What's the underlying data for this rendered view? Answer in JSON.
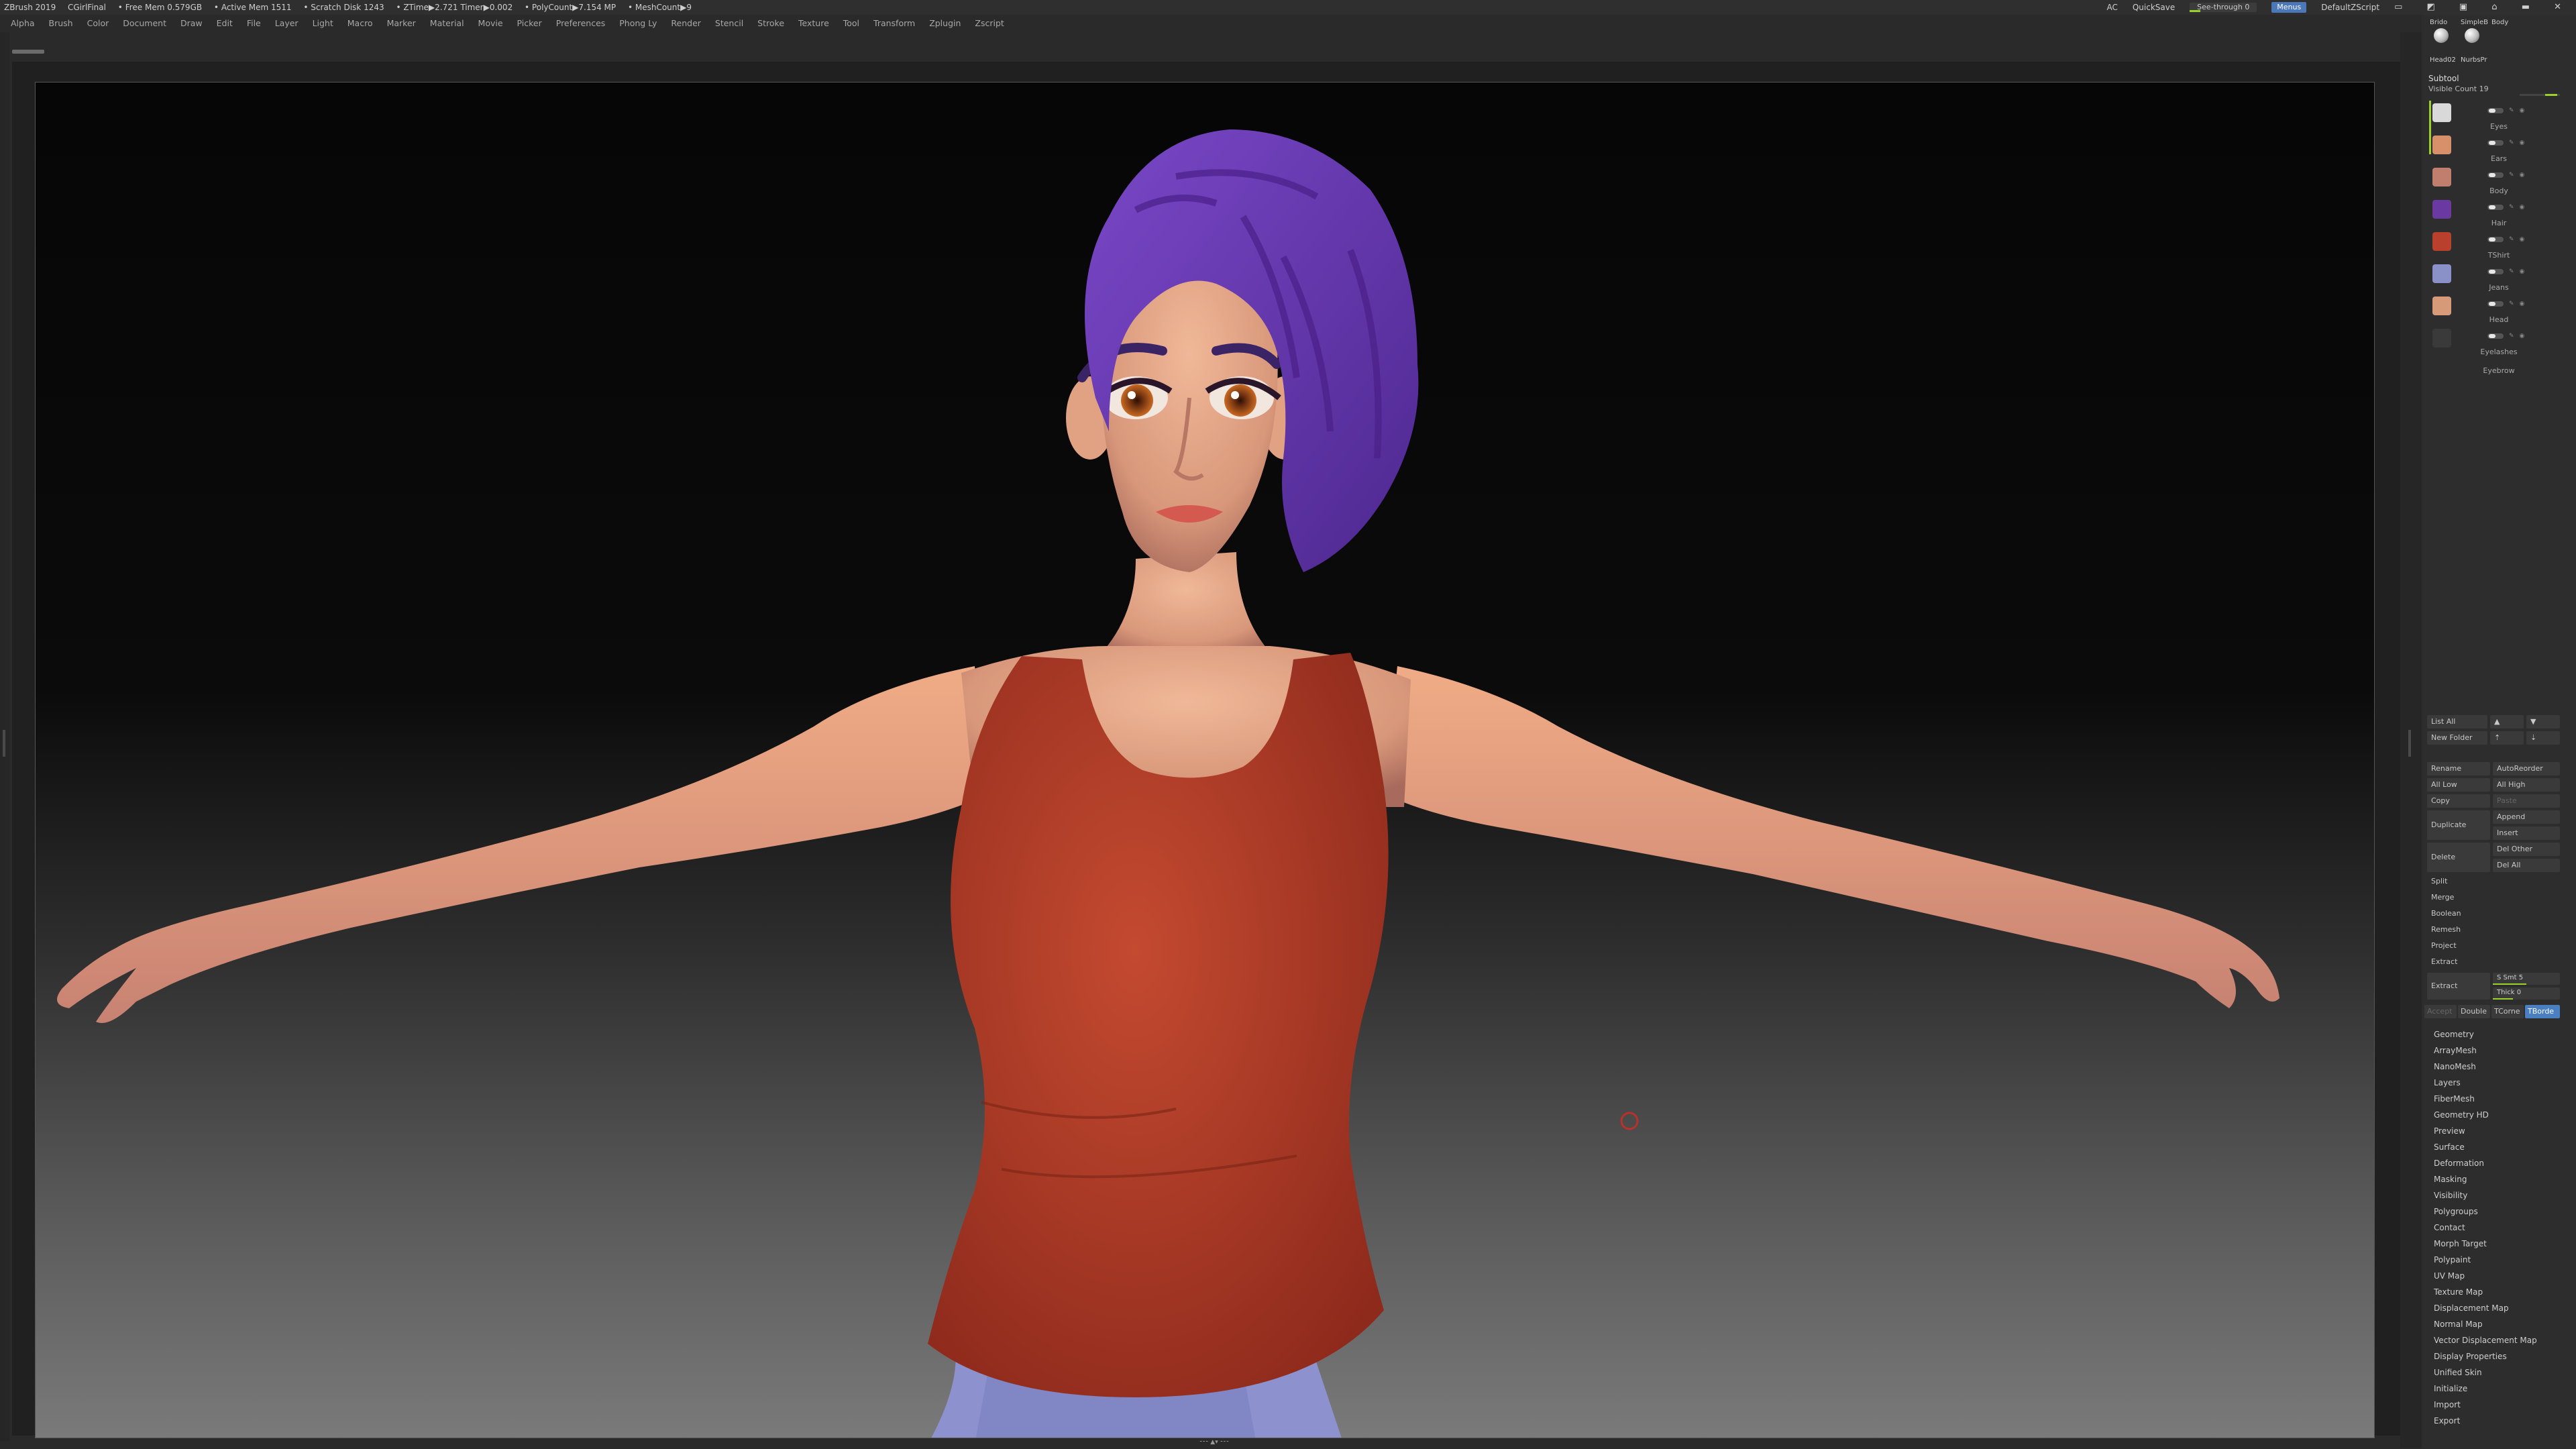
{
  "titlebar": {
    "app": "ZBrush 2019",
    "document": "CGirlFinal",
    "free_mem": "• Free Mem 0.579GB",
    "active_mem": "• Active Mem 1511",
    "scratch": "• Scratch Disk 1243",
    "ztime": "• ZTime▶2.721 Timer▶0.002",
    "polycount": "• PolyCount▶7.154 MP",
    "meshcount": "• MeshCount▶9",
    "ac": "AC",
    "quicksave": "QuickSave",
    "see_through": "See-through  0",
    "menus_btn": "Menus",
    "script": "DefaultZScript",
    "window_controls": "▭ ◩ ▣ ⌂ ▬ ✕"
  },
  "menubar": {
    "items": [
      "Alpha",
      "Brush",
      "Color",
      "Document",
      "Draw",
      "Edit",
      "File",
      "Layer",
      "Light",
      "Macro",
      "Marker",
      "Material",
      "Movie",
      "Picker",
      "Preferences",
      "Phong Ly",
      "Render",
      "Stencil",
      "Stroke",
      "Texture",
      "Tool",
      "Transform",
      "Zplugin",
      "Zscript"
    ]
  },
  "sidebar": {
    "brushes": [
      {
        "top": "Brido",
        "bottom": "Head02"
      },
      {
        "top": "SimpleB",
        "bottom": "NurbsPr"
      },
      {
        "top": "Body",
        "bottom": ""
      }
    ],
    "subtool_header": "Subtool",
    "visible_count": "Visible Count 19",
    "subtools": [
      {
        "name": "Eyes",
        "color": "#d9d9d9"
      },
      {
        "name": "Ears",
        "color": "#d8906a"
      },
      {
        "name": "Body",
        "color": "#c07f6e"
      },
      {
        "name": "Hair",
        "color": "#6a3aa0"
      },
      {
        "name": "TShirt",
        "color": "#b8402c"
      },
      {
        "name": "Jeans",
        "color": "#8a90c8"
      },
      {
        "name": "Head",
        "color": "#d69a78"
      },
      {
        "name": "Eyelashes",
        "color": "#3a3a3a"
      },
      {
        "name": "Eyebrow",
        "color": "#2c2c2c"
      }
    ],
    "list_all": "List All",
    "new_folder": "New Folder",
    "rename": "Rename",
    "autoreorder": "AutoReorder",
    "all_low": "All Low",
    "all_high": "All High",
    "copy": "Copy",
    "paste": "Paste",
    "duplicate": "Duplicate",
    "append": "Append",
    "insert": "Insert",
    "delete": "Delete",
    "del_other": "Del Other",
    "del_all": "Del All",
    "split": "Split",
    "merge": "Merge",
    "boolean": "Boolean",
    "remesh": "Remesh",
    "project": "Project",
    "extract": "Extract",
    "extract_btn": "Extract",
    "s_smt": "S Smt 5",
    "s_smt_level": 0.5,
    "thick": "Thick 0",
    "thick_level": 0.3,
    "accept": "Accept",
    "double": "Double",
    "tcorne": "TCorne",
    "tborder": "TBorde",
    "palettes": [
      "Geometry",
      "ArrayMesh",
      "NanoMesh",
      "Layers",
      "FiberMesh",
      "Geometry HD",
      "Preview",
      "Surface",
      "Deformation",
      "Masking",
      "Visibility",
      "Polygroups",
      "Contact",
      "Morph Target",
      "Polypaint",
      "UV Map",
      "Texture Map",
      "Displacement Map",
      "Normal Map",
      "Vector Displacement Map",
      "Display Properties",
      "Unified Skin",
      "Initialize",
      "Import",
      "Export"
    ]
  },
  "colors": {
    "accent_green": "#9ad12a",
    "accent_blue": "#4a7fc1",
    "hair": "#6a34b0",
    "shirt": "#b43a26",
    "skin": "#e0a282",
    "jeans": "#8d92cf"
  }
}
